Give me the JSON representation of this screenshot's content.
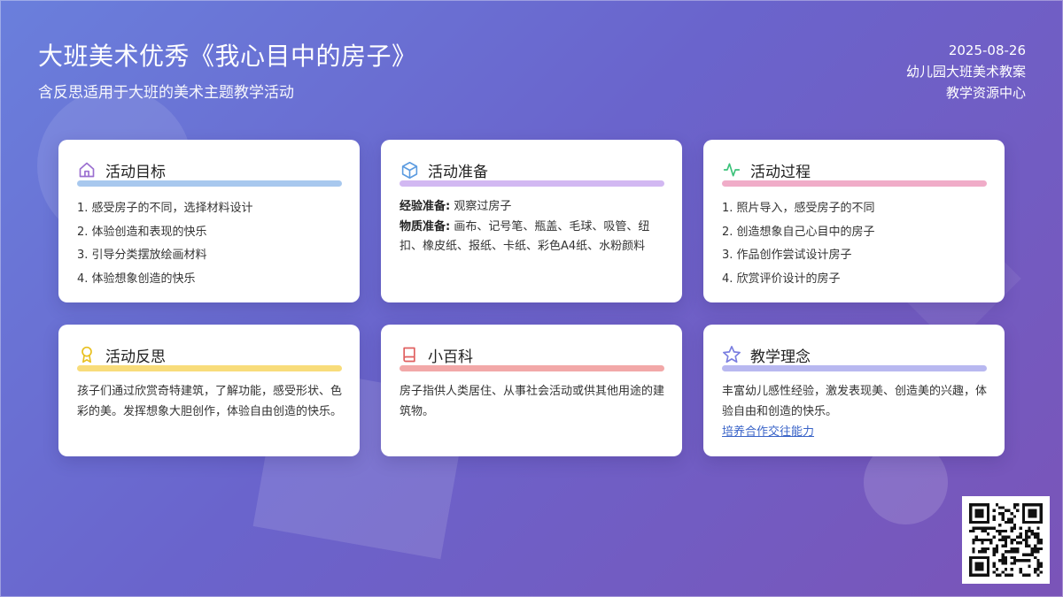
{
  "header": {
    "title": "大班美术优秀《我心目中的房子》",
    "subtitle": "含反思适用于大班的美术主题教学活动"
  },
  "meta": {
    "date": "2025-08-26",
    "category": "幼儿园大班美术教案",
    "source": "教学资源中心"
  },
  "cards": {
    "goals": {
      "title": "活动目标",
      "icon": "home-icon",
      "accent": "#a8c8ee",
      "items": [
        "1. 感受房子的不同，选择材料设计",
        "2. 体验创造和表现的快乐",
        "3. 引导分类摆放绘画材料",
        "4. 体验想象创造的快乐"
      ]
    },
    "prep": {
      "title": "活动准备",
      "icon": "cube-icon",
      "accent": "#d2b8f2",
      "experience_label": "经验准备:",
      "experience_value": " 观察过房子",
      "material_label": "物质准备:",
      "material_value": " 画布、记号笔、瓶盖、毛球、吸管、纽扣、橡皮纸、报纸、卡纸、彩色A4纸、水粉颜料"
    },
    "process": {
      "title": "活动过程",
      "icon": "activity-icon",
      "accent": "#f0acc8",
      "items": [
        "1. 照片导入，感受房子的不同",
        "2. 创造想象自己心目中的房子",
        "3. 作品创作尝试设计房子",
        "4. 欣赏评价设计的房子"
      ]
    },
    "reflection": {
      "title": "活动反思",
      "icon": "award-icon",
      "accent": "#f8dc7a",
      "text": "孩子们通过欣赏奇特建筑，了解功能，感受形状、色彩的美。发挥想象大胆创作，体验自由创造的快乐。"
    },
    "wiki": {
      "title": "小百科",
      "icon": "book-icon",
      "accent": "#f2a8a8",
      "text": "房子指供人类居住、从事社会活动或供其他用途的建筑物。"
    },
    "philosophy": {
      "title": "教学理念",
      "icon": "star-icon",
      "accent": "#b8b8f0",
      "text": "丰富幼儿感性经验，激发表现美、创造美的兴趣，体验自由和创造的快乐。",
      "link": "培养合作交往能力"
    }
  },
  "qr": {
    "icon": "qr-code-icon"
  }
}
